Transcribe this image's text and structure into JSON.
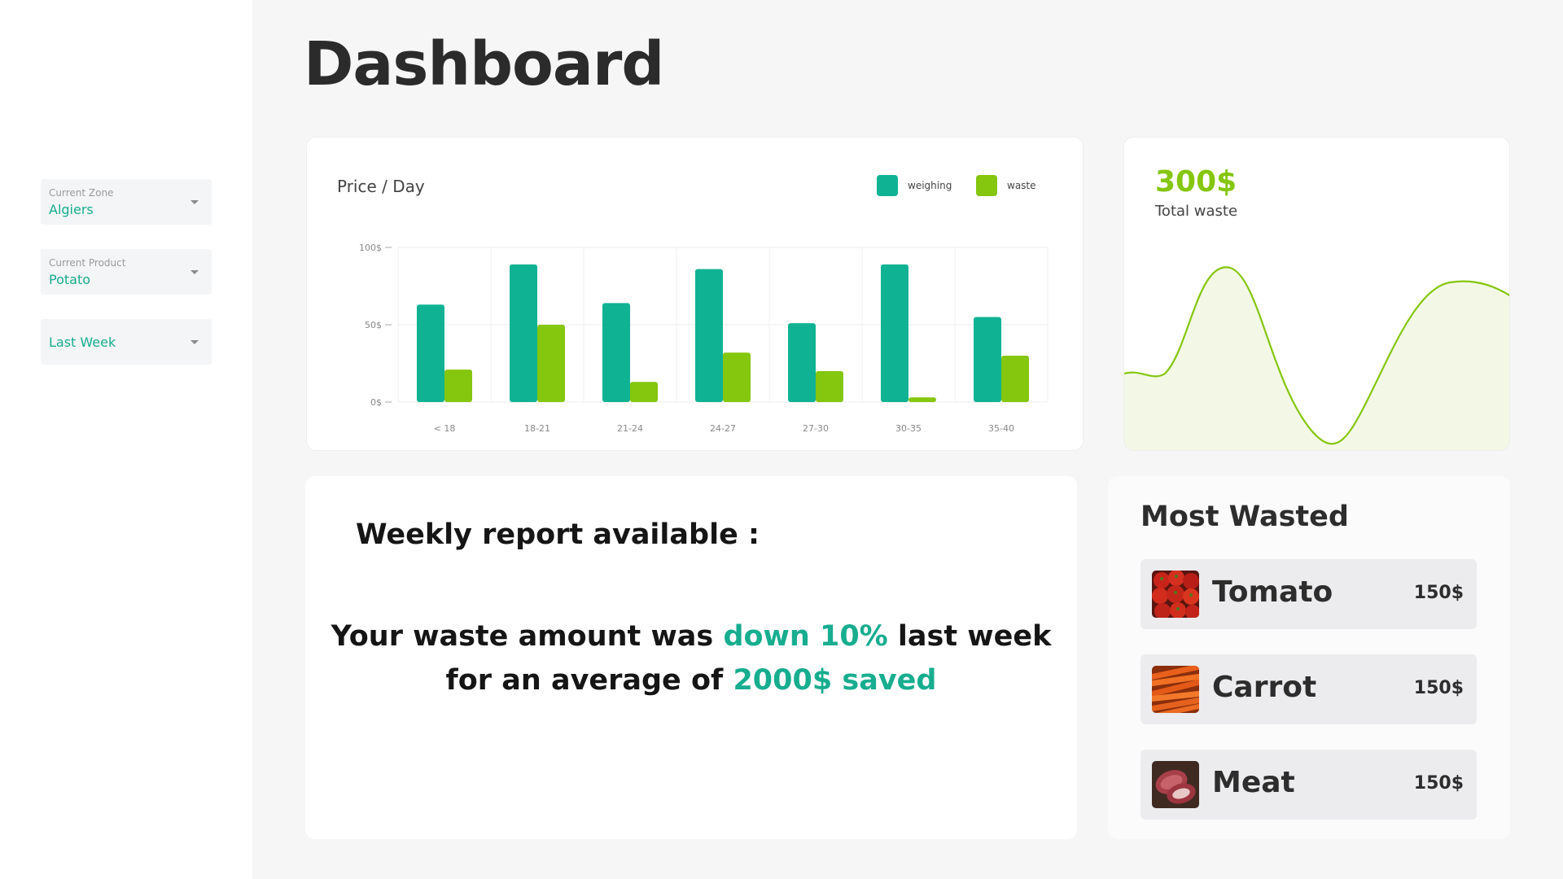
{
  "sidebar": {
    "filters": [
      {
        "label": "Current Zone",
        "value": "Algiers"
      },
      {
        "label": "Current Product",
        "value": "Potato"
      },
      {
        "label": "",
        "value": "Last Week"
      }
    ]
  },
  "page": {
    "title": "Dashboard"
  },
  "colors": {
    "accent": "#17ad8f",
    "teal": "#0fb393",
    "lime": "#85c60e",
    "lime_fill": "#f3f8e6"
  },
  "price_chart": {
    "title": "Price / Day",
    "legend": [
      {
        "name": "weighing",
        "color": "#0fb393"
      },
      {
        "name": "waste",
        "color": "#85c60e"
      }
    ]
  },
  "chart_data": {
    "type": "bar",
    "title": "Price / Day",
    "categories": [
      "< 18",
      "18-21",
      "21-24",
      "24-27",
      "27-30",
      "30-35",
      "35-40"
    ],
    "series": [
      {
        "name": "weighing",
        "color": "#0fb393",
        "values": [
          63,
          89,
          64,
          86,
          51,
          89,
          55
        ]
      },
      {
        "name": "waste",
        "color": "#85c60e",
        "values": [
          21,
          50,
          13,
          32,
          20,
          3,
          30
        ]
      }
    ],
    "yticks": [
      "0$",
      "50$",
      "100$"
    ],
    "ylim": [
      0,
      100
    ],
    "grid": true,
    "legend_position": "top-right"
  },
  "total_waste": {
    "amount": "300$",
    "label": "Total waste"
  },
  "report": {
    "heading": "Weekly report available :",
    "line1_a": "Your waste amount was ",
    "line1_hl": "down 10%",
    "line1_b": " last  week",
    "line2_a": "for an average of ",
    "line2_hl": "2000$ saved"
  },
  "most_wasted": {
    "title": "Most Wasted",
    "items": [
      {
        "name": "Tomato",
        "price": "150$",
        "icon": "tomato-thumbnail"
      },
      {
        "name": "Carrot",
        "price": "150$",
        "icon": "carrot-thumbnail"
      },
      {
        "name": "Meat",
        "price": "150$",
        "icon": "meat-thumbnail"
      }
    ]
  }
}
